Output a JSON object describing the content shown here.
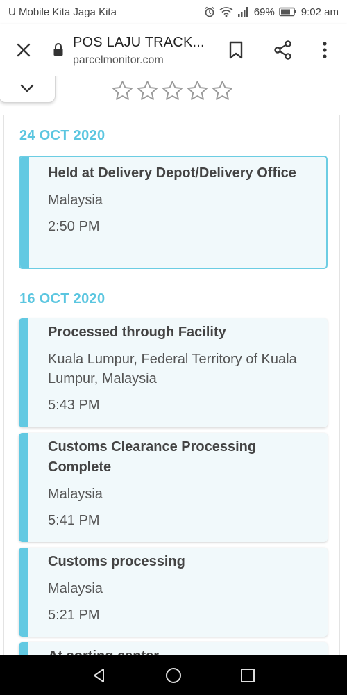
{
  "status_bar": {
    "carrier": "U Mobile Kita Jaga Kita",
    "battery": "69%",
    "time": "9:02 am",
    "icons": [
      "alarm-icon",
      "wifi-icon",
      "signal-icon",
      "battery-icon"
    ]
  },
  "toolbar": {
    "title": "POS LAJU TRACK...",
    "url": "parcelmonitor.com",
    "icons": [
      "close-icon",
      "lock-icon",
      "bookmark-icon",
      "share-icon",
      "more-vert-icon"
    ]
  },
  "rating": {
    "stars": 5,
    "filled": 0
  },
  "groups": [
    {
      "date": "24 OCT 2020",
      "events": [
        {
          "title": "Held at Delivery Depot/Delivery Office",
          "location": "Malaysia",
          "time": "2:50 PM"
        }
      ]
    },
    {
      "date": "16 OCT 2020",
      "events": [
        {
          "title": "Processed through Facility",
          "location": "Kuala Lumpur, Federal Territory of Kuala Lumpur, Malaysia",
          "time": "5:43 PM"
        },
        {
          "title": "Customs Clearance Processing Complete",
          "location": "Malaysia",
          "time": "5:41 PM"
        },
        {
          "title": "Customs processing",
          "location": "Malaysia",
          "time": "5:21 PM"
        },
        {
          "title": "At sorting center",
          "location": "",
          "time": ""
        }
      ]
    }
  ],
  "colors": {
    "accent": "#5bc6e0",
    "card_bg": "#f1f9fb"
  },
  "nav": [
    "back-icon",
    "home-icon",
    "recents-icon"
  ]
}
